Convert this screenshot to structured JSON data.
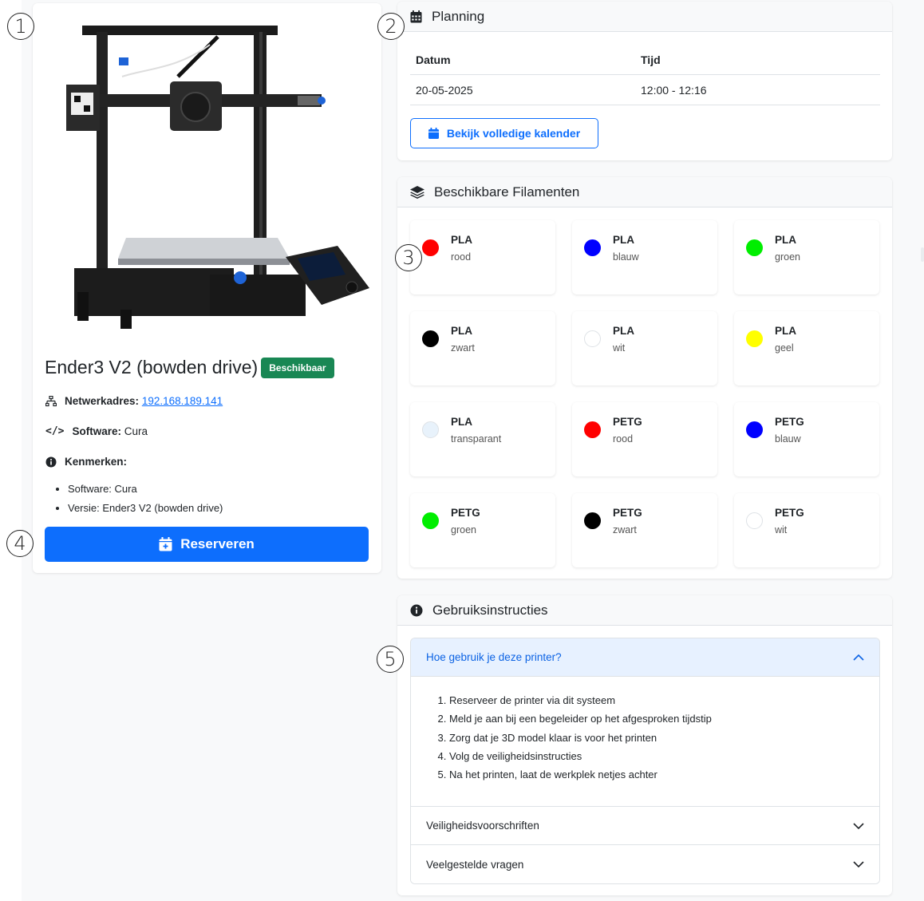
{
  "printer": {
    "name": "Ender3 V2 (bowden drive)",
    "status": "Beschikbaar",
    "network_label": "Netwerkadres:",
    "network_value": "192.168.189.141",
    "software_label": "Software:",
    "software_value": "Cura",
    "features_label": "Kenmerken:",
    "features": [
      "Software: Cura",
      "Versie: Ender3 V2 (bowden drive)"
    ],
    "reserve_label": "Reserveren"
  },
  "planning": {
    "title": "Planning",
    "col_date": "Datum",
    "col_time": "Tijd",
    "rows": [
      {
        "date": "20-05-2025",
        "time": "12:00 - 12:16"
      }
    ],
    "calendar_button": "Bekijk volledige kalender"
  },
  "filaments": {
    "title": "Beschikbare Filamenten",
    "items": [
      {
        "type": "PLA",
        "color": "rood",
        "hex": "#ff0000"
      },
      {
        "type": "PLA",
        "color": "blauw",
        "hex": "#0000ff"
      },
      {
        "type": "PLA",
        "color": "groen",
        "hex": "#00ee00"
      },
      {
        "type": "PLA",
        "color": "zwart",
        "hex": "#000000"
      },
      {
        "type": "PLA",
        "color": "wit",
        "hex": "#ffffff"
      },
      {
        "type": "PLA",
        "color": "geel",
        "hex": "#ffff00"
      },
      {
        "type": "PLA",
        "color": "transparant",
        "hex": "#e8f2fb"
      },
      {
        "type": "PETG",
        "color": "rood",
        "hex": "#ff0000"
      },
      {
        "type": "PETG",
        "color": "blauw",
        "hex": "#0000ff"
      },
      {
        "type": "PETG",
        "color": "groen",
        "hex": "#00ee00"
      },
      {
        "type": "PETG",
        "color": "zwart",
        "hex": "#000000"
      },
      {
        "type": "PETG",
        "color": "wit",
        "hex": "#ffffff"
      }
    ]
  },
  "instructions": {
    "title": "Gebruiksinstructies",
    "sections": [
      {
        "title": "Hoe gebruik je deze printer?",
        "open": true,
        "steps": [
          "Reserveer de printer via dit systeem",
          "Meld je aan bij een begeleider op het afgesproken tijdstip",
          "Zorg dat je 3D model klaar is voor het printen",
          "Volg de veiligheidsinstructies",
          "Na het printen, laat de werkplek netjes achter"
        ]
      },
      {
        "title": "Veiligheidsvoorschriften",
        "open": false
      },
      {
        "title": "Veelgestelde vragen",
        "open": false
      }
    ]
  },
  "callouts": [
    "1",
    "2",
    "3",
    "4",
    "5"
  ],
  "colors": {
    "primary": "#0d6efd",
    "success": "#198754",
    "accordion_open_bg": "#e7f1ff"
  }
}
